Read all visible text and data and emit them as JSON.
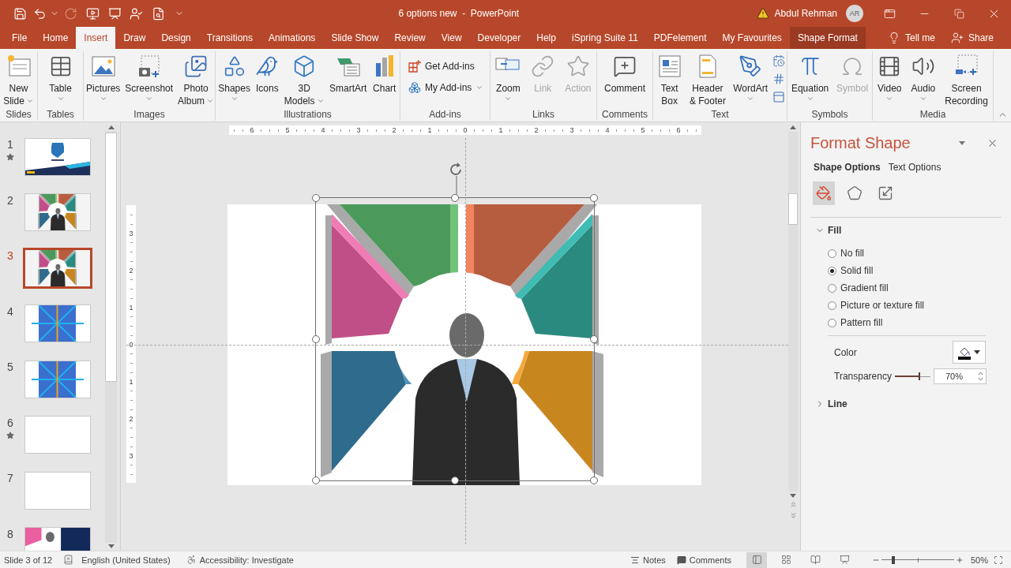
{
  "window": {
    "title": "6 options new  -  PowerPoint",
    "user": "Abdul Rehman",
    "avatar": "AR"
  },
  "quick_access": [
    {
      "disabled": false
    },
    {
      "disabled": false
    },
    {
      "disabled": false
    },
    {
      "disabled": true
    },
    {
      "disabled": false
    },
    {
      "disabled": false
    },
    {
      "disabled": false
    },
    {
      "disabled": false
    },
    {
      "disabled": false
    }
  ],
  "tabs": [
    {
      "label": "File",
      "selected": false,
      "contextual": false
    },
    {
      "label": "Home",
      "selected": false,
      "contextual": false
    },
    {
      "label": "Insert",
      "selected": true,
      "contextual": false
    },
    {
      "label": "Draw",
      "selected": false,
      "contextual": false
    },
    {
      "label": "Design",
      "selected": false,
      "contextual": false
    },
    {
      "label": "Transitions",
      "selected": false,
      "contextual": false
    },
    {
      "label": "Animations",
      "selected": false,
      "contextual": false
    },
    {
      "label": "Slide Show",
      "selected": false,
      "contextual": false
    },
    {
      "label": "Review",
      "selected": false,
      "contextual": false
    },
    {
      "label": "View",
      "selected": false,
      "contextual": false
    },
    {
      "label": "Developer",
      "selected": false,
      "contextual": false
    },
    {
      "label": "Help",
      "selected": false,
      "contextual": false
    },
    {
      "label": "iSpring Suite 11",
      "selected": false,
      "contextual": false
    },
    {
      "label": "PDFelement",
      "selected": false,
      "contextual": false
    },
    {
      "label": "My Favourites",
      "selected": false,
      "contextual": false
    },
    {
      "label": "Shape Format",
      "selected": false,
      "contextual": true
    }
  ],
  "tell_me": "Tell me",
  "share": "Share",
  "ribbon": [
    {
      "label": "Slides",
      "items": [
        {
          "kind": "large",
          "lines": [
            "New",
            "Slide"
          ],
          "caret": true,
          "disabled": false
        }
      ]
    },
    {
      "label": "Tables",
      "items": [
        {
          "kind": "large",
          "lines": [
            "Table"
          ],
          "caret": true,
          "disabled": false
        }
      ]
    },
    {
      "label": "Images",
      "items": [
        {
          "kind": "large",
          "lines": [
            "Pictures"
          ],
          "caret": true,
          "disabled": false
        },
        {
          "kind": "large",
          "lines": [
            "Screenshot"
          ],
          "caret": true,
          "disabled": false
        },
        {
          "kind": "large",
          "lines": [
            "Photo",
            "Album"
          ],
          "caret": true,
          "disabled": false
        }
      ]
    },
    {
      "label": "Illustrations",
      "items": [
        {
          "kind": "large",
          "lines": [
            "Shapes"
          ],
          "caret": true,
          "disabled": false
        },
        {
          "kind": "large",
          "lines": [
            "Icons"
          ],
          "caret": false,
          "disabled": false
        },
        {
          "kind": "large",
          "lines": [
            "3D",
            "Models"
          ],
          "caret": true,
          "disabled": false
        },
        {
          "kind": "large",
          "lines": [
            "SmartArt"
          ],
          "caret": false,
          "disabled": false
        },
        {
          "kind": "large",
          "lines": [
            "Chart"
          ],
          "caret": false,
          "disabled": false
        }
      ]
    },
    {
      "label": "Add-ins",
      "items": [
        {
          "kind": "small",
          "lines": [
            "Get Add-ins"
          ],
          "caret": false,
          "disabled": false
        },
        {
          "kind": "small",
          "lines": [
            "My Add-ins"
          ],
          "caret": true,
          "disabled": false
        }
      ]
    },
    {
      "label": "Links",
      "items": [
        {
          "kind": "large",
          "lines": [
            "Zoom"
          ],
          "caret": true,
          "disabled": false
        },
        {
          "kind": "large",
          "lines": [
            "Link"
          ],
          "caret": false,
          "disabled": true
        },
        {
          "kind": "large",
          "lines": [
            "Action"
          ],
          "caret": false,
          "disabled": true
        }
      ]
    },
    {
      "label": "Comments",
      "items": [
        {
          "kind": "large",
          "lines": [
            "Comment"
          ],
          "caret": false,
          "disabled": false
        }
      ]
    },
    {
      "label": "Text",
      "items": [
        {
          "kind": "large",
          "lines": [
            "Text",
            "Box"
          ],
          "caret": false,
          "disabled": false
        },
        {
          "kind": "large",
          "lines": [
            "Header",
            "& Footer"
          ],
          "caret": false,
          "disabled": false
        },
        {
          "kind": "large",
          "lines": [
            "WordArt"
          ],
          "caret": true,
          "disabled": false
        },
        {
          "kind": "icon-stack"
        }
      ]
    },
    {
      "label": "Symbols",
      "items": [
        {
          "kind": "large",
          "lines": [
            "Equation"
          ],
          "caret": true,
          "disabled": false
        },
        {
          "kind": "large",
          "lines": [
            "Symbol"
          ],
          "caret": false,
          "disabled": true
        }
      ]
    },
    {
      "label": "Media",
      "items": [
        {
          "kind": "large",
          "lines": [
            "Video"
          ],
          "caret": true,
          "disabled": false
        },
        {
          "kind": "large",
          "lines": [
            "Audio"
          ],
          "caret": true,
          "disabled": false
        },
        {
          "kind": "large",
          "lines": [
            "Screen",
            "Recording"
          ],
          "caret": false,
          "disabled": false
        }
      ]
    }
  ],
  "slides": [
    {
      "number": "1",
      "starred": true,
      "selected": false,
      "kind": "title"
    },
    {
      "number": "2",
      "starred": false,
      "selected": false,
      "kind": "diagram"
    },
    {
      "number": "3",
      "starred": false,
      "selected": true,
      "kind": "diagram"
    },
    {
      "number": "4",
      "starred": false,
      "selected": false,
      "kind": "lines"
    },
    {
      "number": "5",
      "starred": false,
      "selected": false,
      "kind": "lines"
    },
    {
      "number": "6",
      "starred": true,
      "selected": false,
      "kind": "plain"
    },
    {
      "number": "7",
      "starred": false,
      "selected": false,
      "kind": "plain"
    },
    {
      "number": "8",
      "starred": false,
      "selected": false,
      "kind": "dark-diagram"
    }
  ],
  "canvas": {
    "horizontal_ruler": [
      "6",
      "5",
      "4",
      "3",
      "2",
      "1",
      "0",
      "1",
      "2",
      "3",
      "4",
      "5",
      "6"
    ],
    "vertical_ruler": [
      "3",
      "2",
      "1",
      "0",
      "1",
      "2",
      "3"
    ],
    "shape_selected": true
  },
  "format_pane": {
    "title": "Format Shape",
    "tabs": [
      {
        "label": "Shape Options",
        "selected": true
      },
      {
        "label": "Text Options",
        "selected": false
      }
    ],
    "icon_tabs": [
      {
        "selected": true
      },
      {
        "selected": false
      },
      {
        "selected": false
      }
    ],
    "fill": {
      "label": "Fill",
      "expanded": true,
      "options": [
        {
          "label": "No fill",
          "selected": false
        },
        {
          "label": "Solid fill",
          "selected": true
        },
        {
          "label": "Gradient fill",
          "selected": false
        },
        {
          "label": "Picture or texture fill",
          "selected": false
        },
        {
          "label": "Pattern fill",
          "selected": false
        }
      ],
      "color_label": "Color",
      "transparency": {
        "label": "Transparency",
        "level": 0.7,
        "value": "70%"
      }
    },
    "line": {
      "label": "Line",
      "expanded": false
    }
  },
  "status_bar": {
    "slide_info": "Slide 3 of 12",
    "language": "English (United States)",
    "accessibility": "Accessibility: Investigate",
    "notes": "Notes",
    "comments": "Comments",
    "views": [
      {
        "selected": true
      },
      {
        "selected": false
      },
      {
        "selected": false
      },
      {
        "selected": false
      }
    ],
    "zoom": {
      "level": 0.16,
      "value": "50%"
    }
  }
}
